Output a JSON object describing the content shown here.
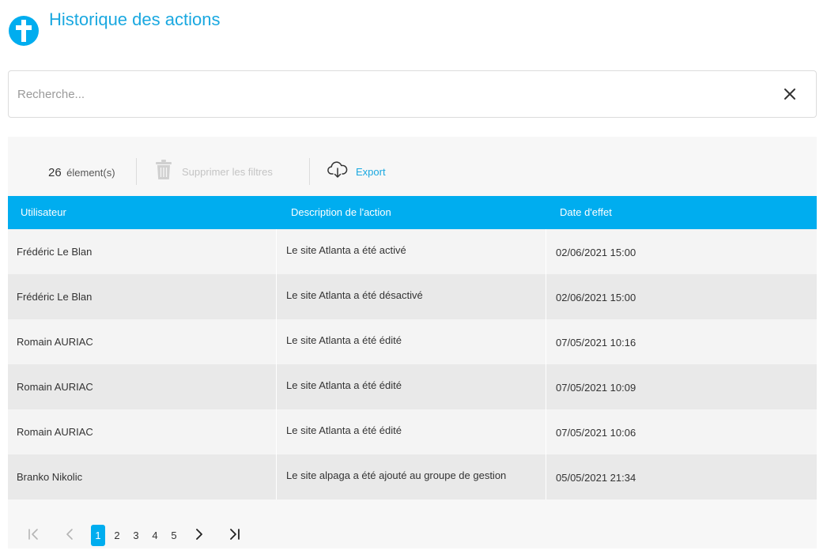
{
  "header": {
    "title": "Historique des actions",
    "logo_icon": "cross-circle-icon",
    "accent_color": "#00adef"
  },
  "search": {
    "placeholder": "Recherche...",
    "value": ""
  },
  "toolbar": {
    "count": "26",
    "count_label": "élement(s)",
    "clear_filters_label": "Supprimer les filtres",
    "export_label": "Export"
  },
  "table": {
    "columns": [
      "Utilisateur",
      "Description de l'action",
      "Date d'effet"
    ],
    "rows": [
      [
        "Frédéric Le Blan",
        "Le site Atlanta a été activé",
        "02/06/2021 15:00"
      ],
      [
        "Frédéric Le Blan",
        "Le site Atlanta a été désactivé",
        "02/06/2021 15:00"
      ],
      [
        "Romain AURIAC",
        "Le site Atlanta a été édité",
        "07/05/2021 10:16"
      ],
      [
        "Romain AURIAC",
        "Le site Atlanta a été édité",
        "07/05/2021 10:09"
      ],
      [
        "Romain AURIAC",
        "Le site Atlanta a été édité",
        "07/05/2021 10:06"
      ],
      [
        "Branko Nikolic",
        "Le site alpaga a été ajouté au groupe de gestion",
        "05/05/2021 21:34"
      ]
    ]
  },
  "pagination": {
    "pages": [
      "1",
      "2",
      "3",
      "4",
      "5"
    ],
    "current": "1"
  }
}
